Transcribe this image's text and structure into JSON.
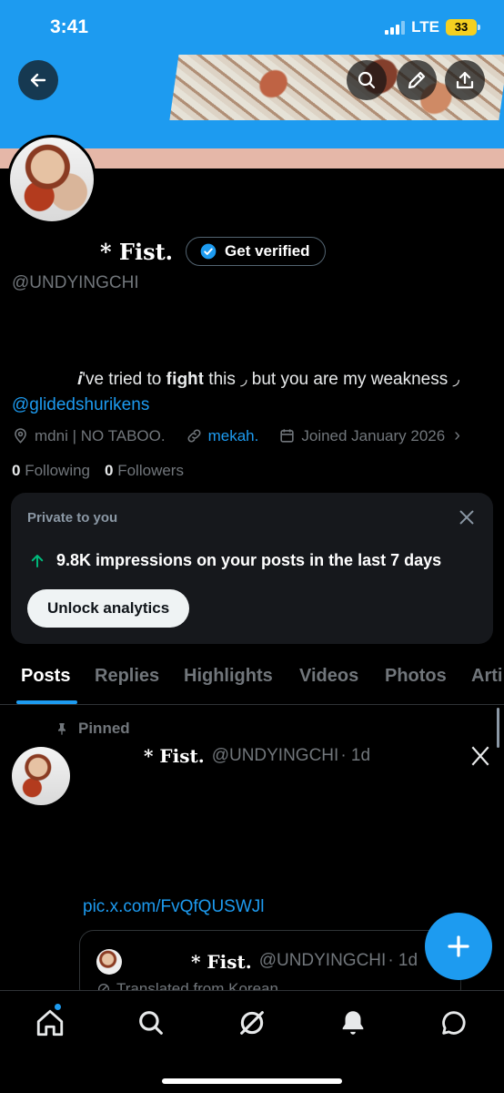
{
  "status_bar": {
    "time": "3:41",
    "network": "LTE",
    "battery": "33"
  },
  "profile": {
    "display_name": "* Fist.",
    "get_verified_label": "Get verified",
    "handle": "@UNDYINGCHI",
    "bio_text": "𝒊've tried to 𝐟𝐢𝐠𝐡𝐭 this ◞ but you are my weakness ◞ ",
    "bio_mention": "@glidedshurikens",
    "location": "mdni | NO TABOO.",
    "website": "mekah.",
    "joined": "Joined January 2026",
    "following_count": "0",
    "following_label": "Following",
    "followers_count": "0",
    "followers_label": "Followers"
  },
  "analytics_card": {
    "title": "Private to you",
    "stat": "9.8K impressions on your posts in the last 7 days",
    "button": "Unlock analytics"
  },
  "tabs": [
    "Posts",
    "Replies",
    "Highlights",
    "Videos",
    "Photos",
    "Arti"
  ],
  "post": {
    "pinned_label": "Pinned",
    "author_name": "* Fist.",
    "author_handle": "@UNDYINGCHI",
    "time": "· 1d",
    "link": "pic.x.com/FvQfQUSWJl",
    "quote": {
      "author_name": "* Fist.",
      "author_handle": "@UNDYINGCHI",
      "time": "· 1d",
      "translated": "Translated from Korean"
    }
  },
  "colors": {
    "accent": "#1d9bf0",
    "background": "#000000",
    "card": "#16181c",
    "muted": "#71767b",
    "banner_strip": "#e5b7a8"
  }
}
